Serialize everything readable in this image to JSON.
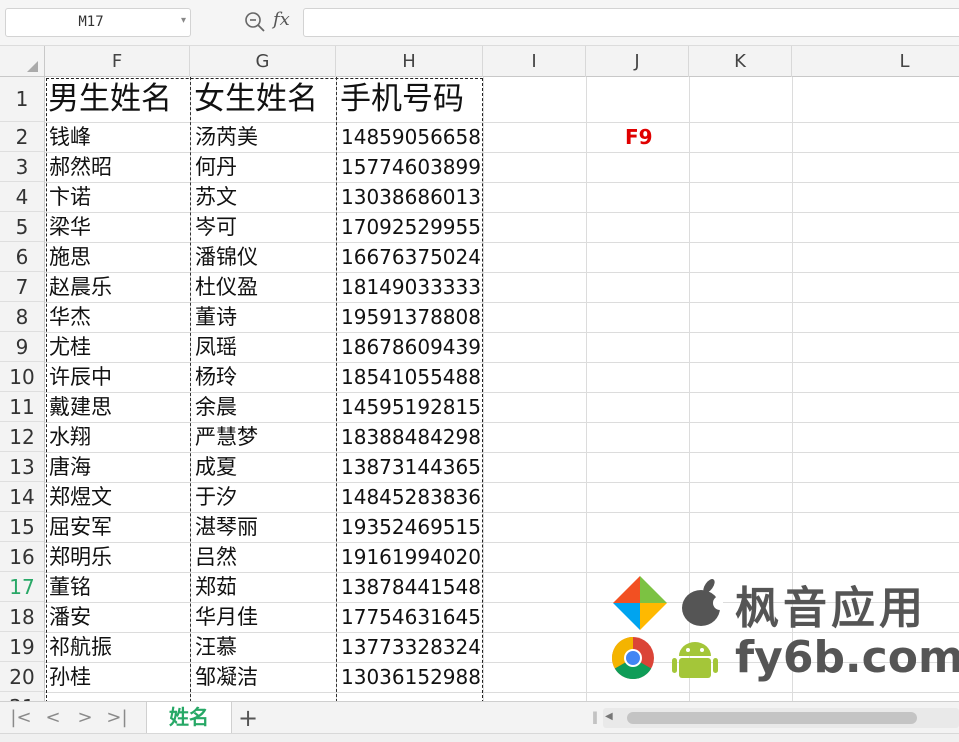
{
  "formula_bar": {
    "cell_ref": "M17",
    "fx_label": "fx",
    "formula": ""
  },
  "columns": [
    "F",
    "G",
    "H",
    "I",
    "J",
    "K",
    "L"
  ],
  "rows": [
    "1",
    "2",
    "3",
    "4",
    "5",
    "6",
    "7",
    "8",
    "9",
    "10",
    "11",
    "12",
    "13",
    "14",
    "15",
    "16",
    "17",
    "18",
    "19",
    "20",
    "21"
  ],
  "active_row": "17",
  "table": {
    "headers": [
      "男生姓名",
      "女生姓名",
      "手机号码"
    ],
    "rows": [
      [
        "钱峰",
        "汤芮美",
        "14859056658"
      ],
      [
        "郝然昭",
        "何丹",
        "15774603899"
      ],
      [
        "卞诺",
        "苏文",
        "13038686013"
      ],
      [
        "梁华",
        "岑可",
        "17092529955"
      ],
      [
        "施思",
        "潘锦仪",
        "16676375024"
      ],
      [
        "赵晨乐",
        "杜仪盈",
        "18149033333"
      ],
      [
        "华杰",
        "董诗",
        "19591378808"
      ],
      [
        "尤桂",
        "凤瑶",
        "18678609439"
      ],
      [
        "许辰中",
        "杨玲",
        "18541055488"
      ],
      [
        "戴建思",
        "余晨",
        "14595192815"
      ],
      [
        "水翔",
        "严慧梦",
        "18388484298"
      ],
      [
        "唐海",
        "成夏",
        "13873144365"
      ],
      [
        "郑煜文",
        "于汐",
        "14845283836"
      ],
      [
        "屈安军",
        "湛琴丽",
        "19352469515"
      ],
      [
        "郑明乐",
        "吕然",
        "19161994020"
      ],
      [
        "董铭",
        "郑茹",
        "13878441548"
      ],
      [
        "潘安",
        "华月佳",
        "17754631645"
      ],
      [
        "祁航振",
        "汪慕",
        "13773328324"
      ],
      [
        "孙桂",
        "邹凝洁",
        "13036152988"
      ]
    ]
  },
  "j2_text": "F9",
  "watermark": {
    "title": "枫音应用",
    "domain": "fy6b.com"
  },
  "sheet_tabs": {
    "active": "姓名",
    "add_label": "+",
    "nav": [
      "|<",
      "<",
      ">",
      ">|"
    ]
  },
  "icons": {
    "zoom": "zoom-formula-icon",
    "fx": "fx-icon",
    "dropdown": "chevron-down-icon"
  },
  "colors": {
    "accent_green": "#27a866",
    "f9_red": "#e00000"
  }
}
